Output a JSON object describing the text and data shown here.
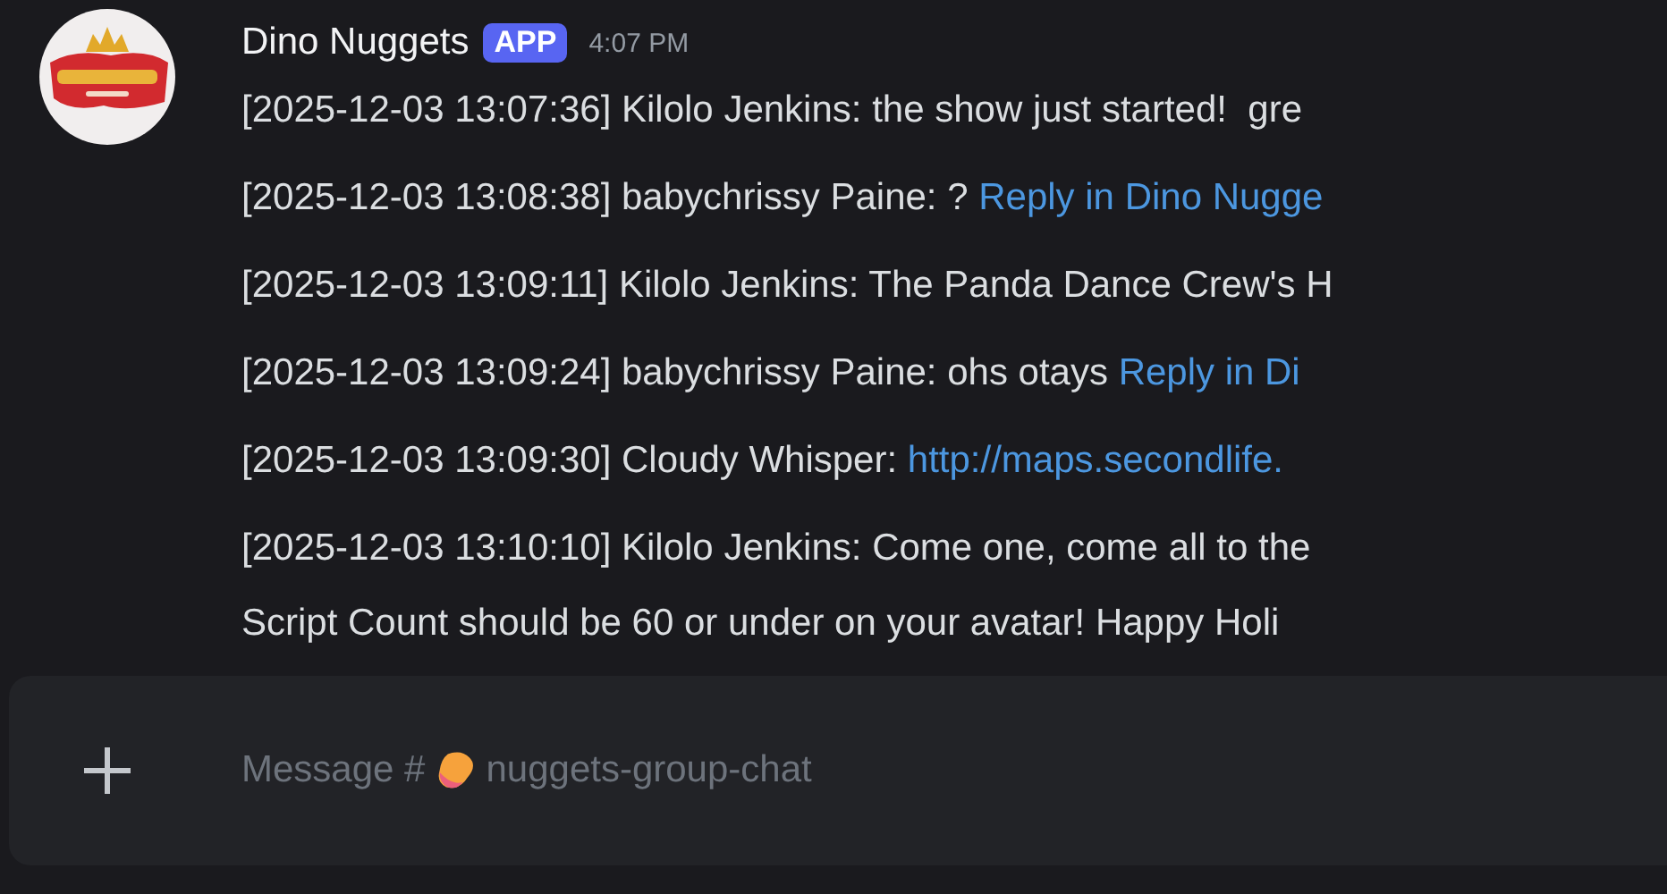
{
  "message": {
    "author": "Dino Nuggets",
    "badge": "APP",
    "time": "4:07 PM",
    "lines": [
      {
        "text": "[2025-12-03 13:07:36] Kilolo Jenkins: the show just started!  gre"
      },
      {
        "text": "[2025-12-03 13:08:38] babychrissy Paine: ? ",
        "link": "Reply in Dino Nugge"
      },
      {
        "text": "[2025-12-03 13:09:11] Kilolo Jenkins: The Panda Dance Crew's H"
      },
      {
        "text": "[2025-12-03 13:09:24] babychrissy Paine: ohs otays ",
        "link": "Reply in Di"
      },
      {
        "text": "[2025-12-03 13:09:30] Cloudy Whisper: ",
        "link": "http://maps.secondlife."
      },
      {
        "text": "[2025-12-03 13:10:10] Kilolo Jenkins: Come one, come all to the",
        "continuation": "Script Count should be 60 or under on your avatar! Happy Holi"
      }
    ]
  },
  "composer": {
    "placeholder": "Message #",
    "channel": "nuggets-group-chat"
  }
}
